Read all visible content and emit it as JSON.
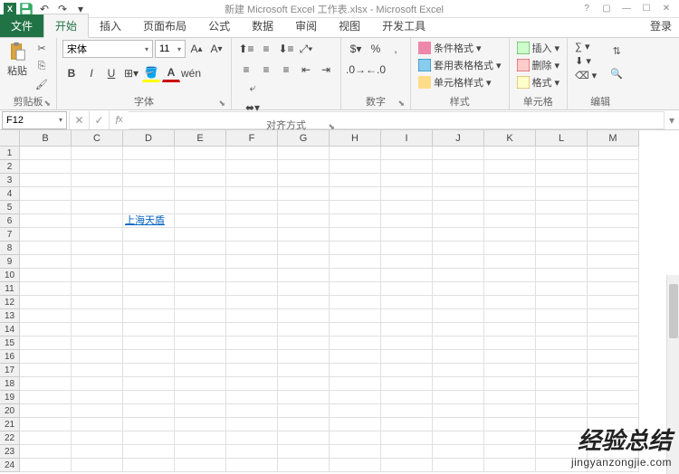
{
  "title": "新建 Microsoft Excel 工作表.xlsx - Microsoft Excel",
  "login_label": "登录",
  "tabs": {
    "file": "文件",
    "home": "开始",
    "insert": "插入",
    "pagelayout": "页面布局",
    "formulas": "公式",
    "data": "数据",
    "review": "审阅",
    "view": "视图",
    "developer": "开发工具"
  },
  "ribbon": {
    "clipboard": {
      "label": "剪贴板",
      "paste": "粘贴"
    },
    "font": {
      "label": "字体",
      "name": "宋体",
      "size": "11"
    },
    "alignment": {
      "label": "对齐方式"
    },
    "number": {
      "label": "数字"
    },
    "styles": {
      "label": "样式",
      "cond": "条件格式",
      "table": "套用表格格式",
      "cell": "单元格样式"
    },
    "cells": {
      "label": "单元格",
      "insert": "插入",
      "delete": "删除",
      "format": "格式"
    },
    "editing": {
      "label": "编辑"
    }
  },
  "namebox": "F12",
  "columns": [
    "B",
    "C",
    "D",
    "E",
    "F",
    "G",
    "H",
    "I",
    "J",
    "K",
    "L",
    "M"
  ],
  "rows": [
    1,
    2,
    3,
    4,
    5,
    6,
    7,
    8,
    9,
    10,
    11,
    12,
    13,
    14,
    15,
    16,
    17,
    18,
    19,
    20,
    21,
    22,
    23,
    24
  ],
  "cell_d6": "上海天盾",
  "watermark": {
    "text": "经验总结",
    "url": "jingyanzongjie.com"
  }
}
